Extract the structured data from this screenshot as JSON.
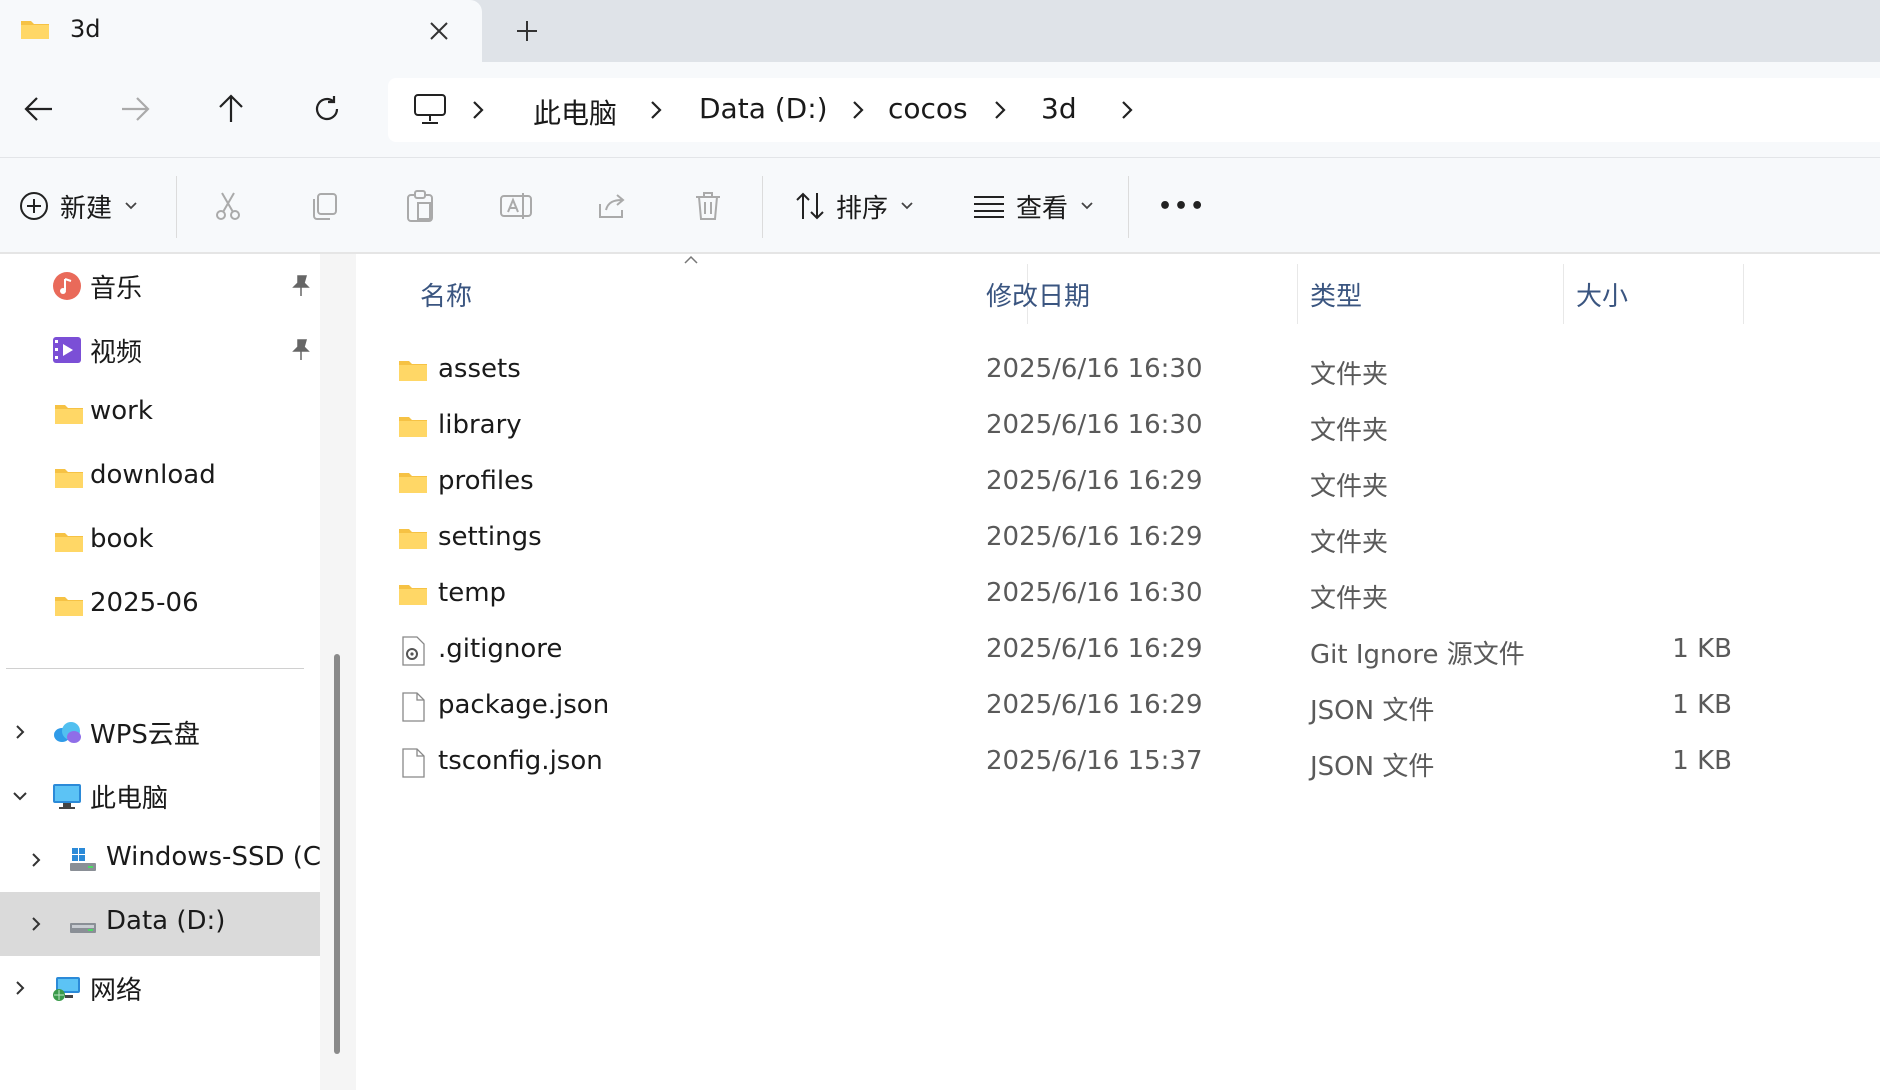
{
  "tab": {
    "title": "3d",
    "close": "✕",
    "new": "+"
  },
  "breadcrumb": {
    "items": [
      "此电脑",
      "Data (D:)",
      "cocos",
      "3d"
    ]
  },
  "commands": {
    "new_label": "新建",
    "sort_label": "排序",
    "view_label": "查看",
    "more": "•••"
  },
  "sidebar": {
    "pinned": [
      {
        "label": "音乐"
      },
      {
        "label": "视频"
      },
      {
        "label": "work"
      },
      {
        "label": "download"
      },
      {
        "label": "book"
      },
      {
        "label": "2025-06"
      }
    ],
    "tree": [
      {
        "label": "WPS云盘"
      },
      {
        "label": "此电脑"
      },
      {
        "label": "Windows-SSD (C:)"
      },
      {
        "label": "Data (D:)"
      },
      {
        "label": "网络"
      }
    ]
  },
  "columns": {
    "name": "名称",
    "date": "修改日期",
    "type": "类型",
    "size": "大小"
  },
  "files": [
    {
      "name": "assets",
      "date": "2025/6/16 16:30",
      "type": "文件夹",
      "size": ""
    },
    {
      "name": "library",
      "date": "2025/6/16 16:30",
      "type": "文件夹",
      "size": ""
    },
    {
      "name": "profiles",
      "date": "2025/6/16 16:29",
      "type": "文件夹",
      "size": ""
    },
    {
      "name": "settings",
      "date": "2025/6/16 16:29",
      "type": "文件夹",
      "size": ""
    },
    {
      "name": "temp",
      "date": "2025/6/16 16:30",
      "type": "文件夹",
      "size": ""
    },
    {
      "name": ".gitignore",
      "date": "2025/6/16 16:29",
      "type": "Git Ignore 源文件",
      "size": "1 KB"
    },
    {
      "name": "package.json",
      "date": "2025/6/16 16:29",
      "type": "JSON 文件",
      "size": "1 KB"
    },
    {
      "name": "tsconfig.json",
      "date": "2025/6/16 15:37",
      "type": "JSON 文件",
      "size": "1 KB"
    }
  ],
  "colors": {
    "folder": "#f6c244",
    "accent": "#0067c0",
    "header_text": "#3a5580",
    "selected_bg": "#dadada"
  }
}
